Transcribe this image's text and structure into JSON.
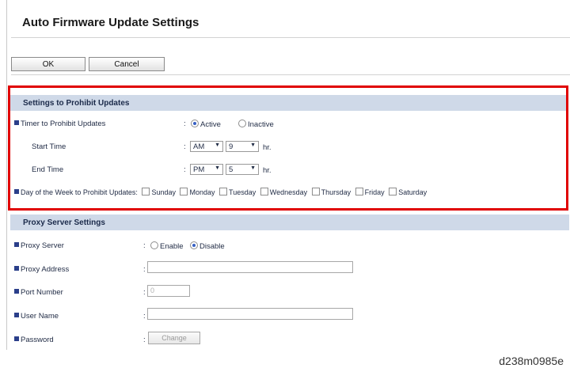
{
  "title": "Auto Firmware Update Settings",
  "buttons": {
    "ok": "OK",
    "cancel": "Cancel"
  },
  "prohibit": {
    "header": "Settings to Prohibit Updates",
    "timer_label": "Timer to Prohibit Updates",
    "active": "Active",
    "inactive": "Inactive",
    "timer_selected": "Active",
    "start_label": "Start Time",
    "start_ampm": "AM",
    "start_hour": "9",
    "end_label": "End Time",
    "end_ampm": "PM",
    "end_hour": "5",
    "hr": "hr.",
    "day_label": "Day of the Week to Prohibit Updates:",
    "days": [
      "Sunday",
      "Monday",
      "Tuesday",
      "Wednesday",
      "Thursday",
      "Friday",
      "Saturday"
    ]
  },
  "proxy": {
    "header": "Proxy Server Settings",
    "server_label": "Proxy Server",
    "enable": "Enable",
    "disable": "Disable",
    "server_selected": "Disable",
    "address_label": "Proxy Address",
    "address_value": "",
    "port_label": "Port Number",
    "port_value": "0",
    "user_label": "User Name",
    "user_value": "",
    "password_label": "Password",
    "change": "Change"
  },
  "figure_id": "d238m0985e"
}
